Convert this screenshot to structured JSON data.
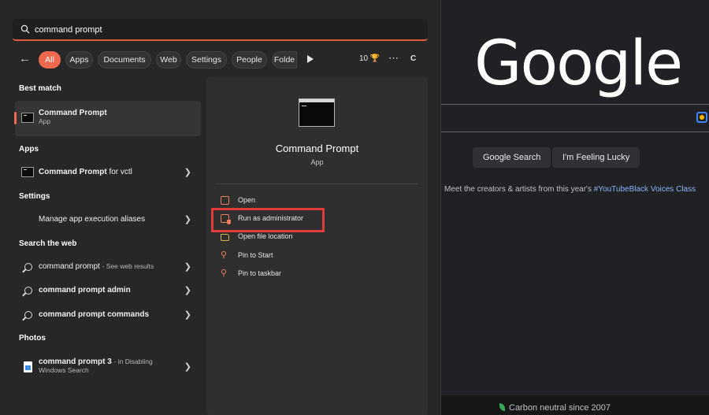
{
  "search": {
    "query": "command prompt"
  },
  "filters": {
    "chips": [
      "All",
      "Apps",
      "Documents",
      "Web",
      "Settings",
      "People",
      "Folde"
    ],
    "points": "10",
    "account_initial": "C"
  },
  "sections": {
    "best_match": "Best match",
    "apps": "Apps",
    "settings": "Settings",
    "search_web": "Search the web",
    "photos": "Photos"
  },
  "results": {
    "best": {
      "title": "Command Prompt",
      "type": "App"
    },
    "app": {
      "title": "Command Prompt",
      "suffix": "for vctl"
    },
    "setting": {
      "title": "Manage app execution aliases"
    },
    "web": [
      {
        "title": "command prompt",
        "suffix": "- See web results"
      },
      {
        "title": "command prompt admin",
        "suffix": ""
      },
      {
        "title": "command prompt commands",
        "suffix": ""
      }
    ],
    "photo": {
      "title": "command prompt 3",
      "suffix": "- in Disabling",
      "location": "Windows Search"
    }
  },
  "preview": {
    "title": "Command Prompt",
    "type": "App",
    "actions": [
      "Open",
      "Run as administrator",
      "Open file location",
      "Pin to Start",
      "Pin to taskbar"
    ]
  },
  "google": {
    "logo": "Google",
    "search_button": "Google Search",
    "lucky_button": "I'm Feeling Lucky",
    "promo_text": "Meet the creators & artists from this year's",
    "promo_link": "#YouTubeBlack Voices Class",
    "footer": "Carbon neutral since 2007"
  },
  "colors": {
    "accent": "#ef6950",
    "highlight": "#e03c3c",
    "link": "#8ab4f8"
  }
}
